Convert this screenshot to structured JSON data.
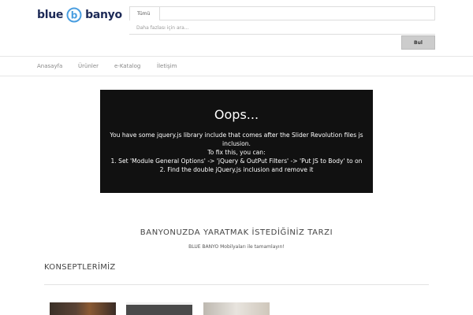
{
  "brand": {
    "name_part1": "blue",
    "name_part2": "banyo",
    "logo_mark": "b",
    "brand_color": "#1d2a57"
  },
  "search": {
    "category": "Tümü",
    "placeholder": "Daha fazlası için ara...",
    "button_label": "Bul"
  },
  "nav": {
    "items": [
      {
        "label": "Anasayfa"
      },
      {
        "label": "Ürünler"
      },
      {
        "label": "e-Katalog"
      },
      {
        "label": "İletişim"
      }
    ]
  },
  "error": {
    "title": "Oops...",
    "line1": "You have some jquery.js library include that comes after the Slider Revolution files js inclusion.",
    "line2": "To fix this, you can:",
    "line3": "1. Set 'Module General Options' -> 'jQuery & OutPut Filters' -> 'Put JS to Body' to on",
    "line4": "2. Find the double jQuery.js inclusion and remove it"
  },
  "main": {
    "heading": "BANYONUZDA YARATMAK İSTEDİĞİNİZ TARZI",
    "subheading": "BLUE BANYO Mobilyaları ile tamamlayın!",
    "concepts_title": "KONSEPTLERİMİZ"
  }
}
